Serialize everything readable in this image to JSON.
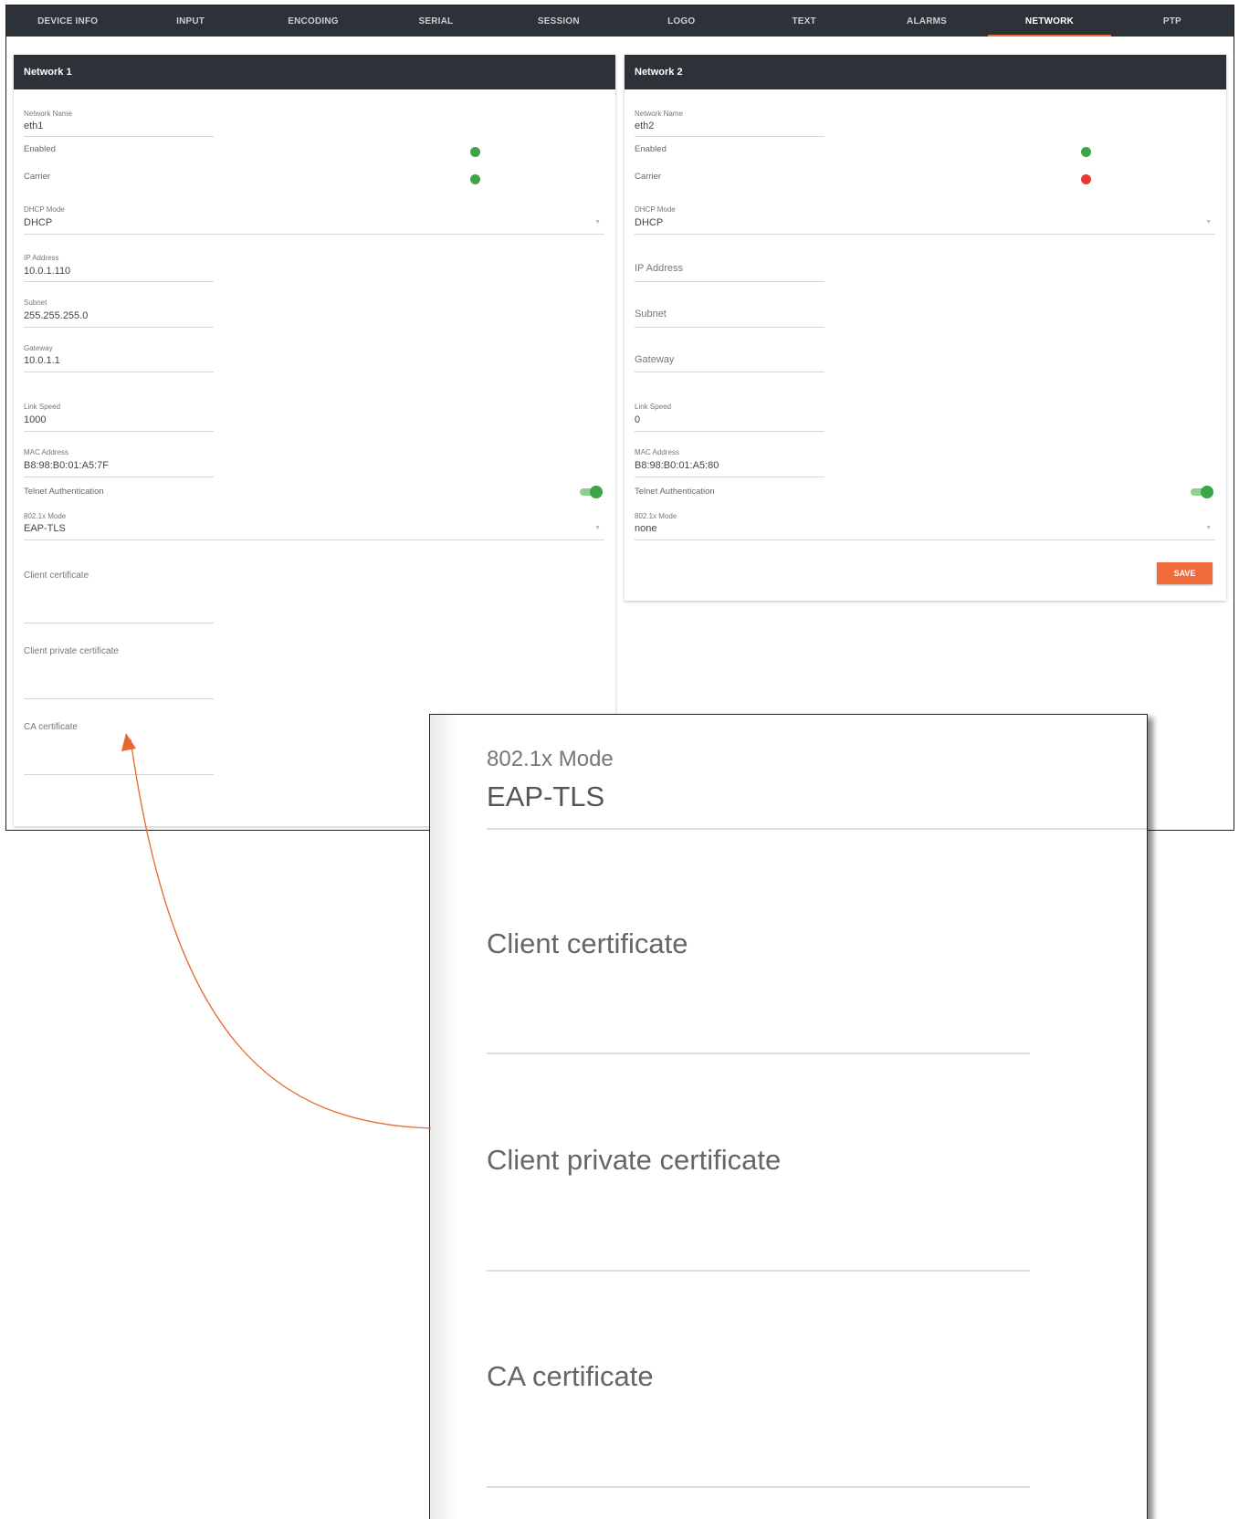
{
  "tabs": [
    {
      "label": "DEVICE INFO",
      "active": false
    },
    {
      "label": "INPUT",
      "active": false
    },
    {
      "label": "ENCODING",
      "active": false
    },
    {
      "label": "SERIAL",
      "active": false
    },
    {
      "label": "SESSION",
      "active": false
    },
    {
      "label": "LOGO",
      "active": false
    },
    {
      "label": "TEXT",
      "active": false
    },
    {
      "label": "ALARMS",
      "active": false
    },
    {
      "label": "NETWORK",
      "active": true
    },
    {
      "label": "PTP",
      "active": false
    }
  ],
  "network1": {
    "title": "Network 1",
    "network_name": {
      "label": "Network Name",
      "value": "eth1"
    },
    "enabled": {
      "label": "Enabled",
      "status_color": "#3aa646"
    },
    "carrier": {
      "label": "Carrier",
      "status_color": "#3aa646"
    },
    "dhcp_mode": {
      "label": "DHCP Mode",
      "value": "DHCP"
    },
    "ip_address": {
      "label": "IP Address",
      "value": "10.0.1.110"
    },
    "subnet": {
      "label": "Subnet",
      "value": "255.255.255.0"
    },
    "gateway": {
      "label": "Gateway",
      "value": "10.0.1.1"
    },
    "link_speed": {
      "label": "Link Speed",
      "value": "1000"
    },
    "mac_address": {
      "label": "MAC Address",
      "value": "B8:98:B0:01:A5:7F"
    },
    "telnet_auth": {
      "label": "Telnet Authentication",
      "on": true
    },
    "mode_8021x": {
      "label": "802.1x Mode",
      "value": "EAP-TLS"
    },
    "client_cert": {
      "label": "Client certificate"
    },
    "client_private_cert": {
      "label": "Client private certificate"
    },
    "ca_cert": {
      "label": "CA certificate"
    }
  },
  "network2": {
    "title": "Network 2",
    "network_name": {
      "label": "Network Name",
      "value": "eth2"
    },
    "enabled": {
      "label": "Enabled",
      "status_color": "#3aa646"
    },
    "carrier": {
      "label": "Carrier",
      "status_color": "#e53935"
    },
    "dhcp_mode": {
      "label": "DHCP Mode",
      "value": "DHCP"
    },
    "ip_address": {
      "placeholder": "IP Address"
    },
    "subnet": {
      "placeholder": "Subnet"
    },
    "gateway": {
      "placeholder": "Gateway"
    },
    "link_speed": {
      "label": "Link Speed",
      "value": "0"
    },
    "mac_address": {
      "label": "MAC Address",
      "value": "B8:98:B0:01:A5:80"
    },
    "telnet_auth": {
      "label": "Telnet Authentication",
      "on": true
    },
    "mode_8021x": {
      "label": "802.1x Mode",
      "value": "none"
    },
    "save_label": "SAVE"
  },
  "zoom": {
    "mode_label": "802.1x Mode",
    "mode_value": "EAP-TLS",
    "client_cert_label": "Client certificate",
    "client_private_cert_label": "Client private certificate",
    "ca_cert_label": "CA certificate"
  },
  "colors": {
    "header_bg": "#2c3237",
    "accent": "#f26b3a",
    "status_green": "#3aa646",
    "status_red": "#e53935",
    "arrow": "#e8672f"
  }
}
